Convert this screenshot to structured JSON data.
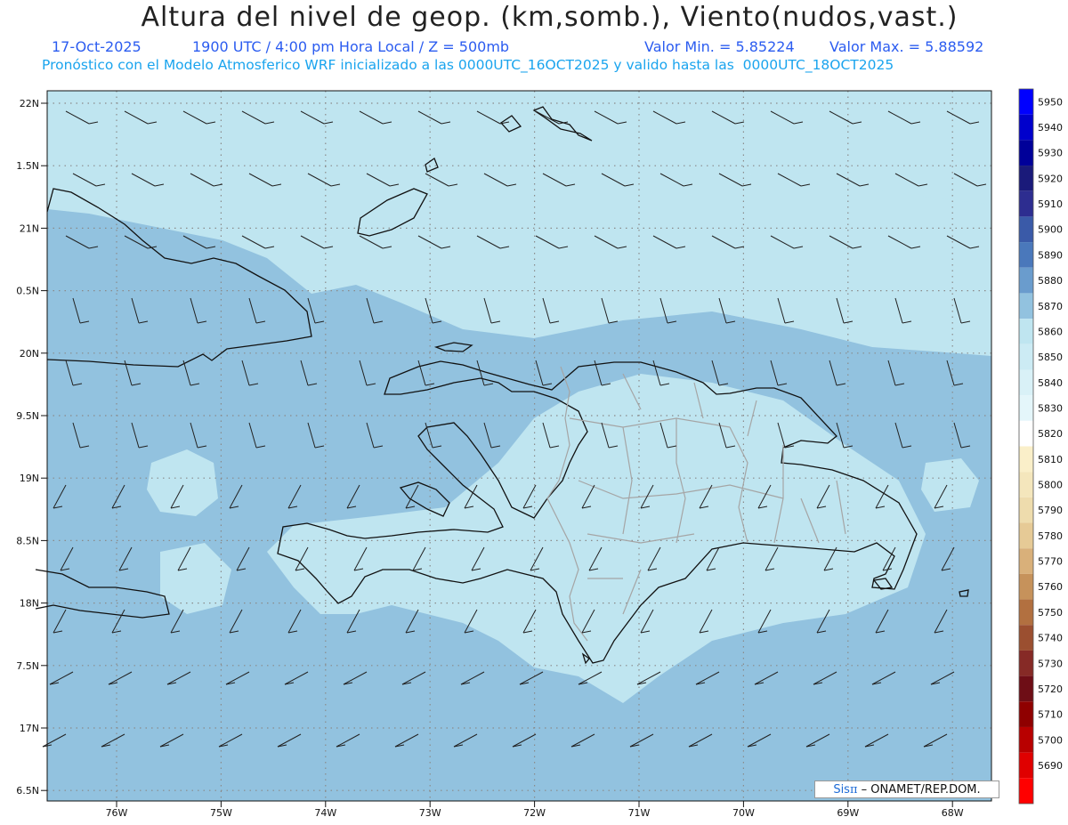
{
  "header": {
    "title": "Altura del nivel de geop. (km,somb.), Viento(nudos,vast.)",
    "line2_date": "17-Oct-2025",
    "line2_time": "1900 UTC / 4:00 pm Hora Local / Z = 500mb",
    "line2_min": "Valor Min. = 5.85224",
    "line2_max": "Valor Max. = 5.88592",
    "line3": "Pronóstico con el Modelo Atmosferico WRF inicializado a las 0000UTC_16OCT2025 y valido hasta las  0000UTC_18OCT2025"
  },
  "map": {
    "lat_labels": [
      "22N",
      "1.5N",
      "21N",
      "0.5N",
      "20N",
      "9.5N",
      "19N",
      "8.5N",
      "18N",
      "7.5N",
      "17N",
      "6.5N"
    ],
    "lon_labels": [
      "76W",
      "75W",
      "74W",
      "73W",
      "72W",
      "71W",
      "70W",
      "69W",
      "68W"
    ],
    "background_color": "#92c2df",
    "light_band_color": "#bfe5f0",
    "coast_color": "#111111",
    "border_color": "#a5a5a5",
    "barb_color": "#222222"
  },
  "colorbar": {
    "entries": [
      {
        "label": "5950",
        "color": "#0000ff"
      },
      {
        "label": "5940",
        "color": "#0000cc"
      },
      {
        "label": "5930",
        "color": "#000099"
      },
      {
        "label": "5920",
        "color": "#1a1a7a"
      },
      {
        "label": "5910",
        "color": "#2d2d90"
      },
      {
        "label": "5900",
        "color": "#3a5aa8"
      },
      {
        "label": "5890",
        "color": "#4a78bb"
      },
      {
        "label": "5880",
        "color": "#6a9ccd"
      },
      {
        "label": "5870",
        "color": "#92c2df"
      },
      {
        "label": "5860",
        "color": "#bfe5f0"
      },
      {
        "label": "5850",
        "color": "#ccebf4"
      },
      {
        "label": "5840",
        "color": "#d9f1f7"
      },
      {
        "label": "5830",
        "color": "#e4f6fa"
      },
      {
        "label": "5820",
        "color": "#ffffff"
      },
      {
        "label": "5810",
        "color": "#faefc9"
      },
      {
        "label": "5800",
        "color": "#f4e6bc"
      },
      {
        "label": "5790",
        "color": "#eedcad"
      },
      {
        "label": "5780",
        "color": "#e6ca96"
      },
      {
        "label": "5770",
        "color": "#d9b07a"
      },
      {
        "label": "5760",
        "color": "#c6925b"
      },
      {
        "label": "5750",
        "color": "#b27040"
      },
      {
        "label": "5740",
        "color": "#9b4f30"
      },
      {
        "label": "5730",
        "color": "#862a26"
      },
      {
        "label": "5720",
        "color": "#6e0e16"
      },
      {
        "label": "5710",
        "color": "#8f0000"
      },
      {
        "label": "5700",
        "color": "#b80000"
      },
      {
        "label": "5690",
        "color": "#e00000"
      },
      {
        "label": "",
        "color": "#ff0000"
      }
    ]
  },
  "credit": {
    "sis": "Sis",
    "pi": "π",
    "text": "– ONAMET/REP.DOM."
  }
}
